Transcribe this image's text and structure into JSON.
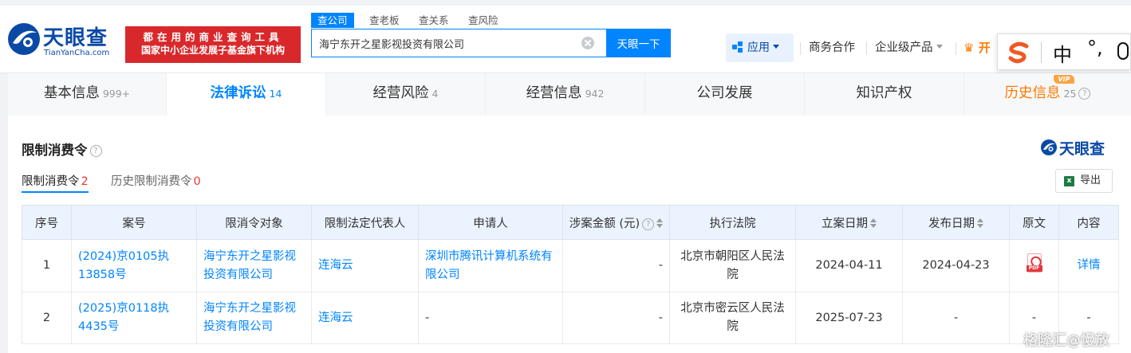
{
  "header": {
    "logo_cn": "天眼查",
    "logo_en": "TianYanCha.com",
    "slogan_line1": "都在用的商业查询工具",
    "slogan_line2": "国家中小企业发展子基金旗下机构",
    "search_tabs": [
      "查公司",
      "查老板",
      "查关系",
      "查风险"
    ],
    "search_value": "海宁东开之星影视投资有限公司",
    "search_button": "天眼一下",
    "app_label": "应用",
    "nav_business": "商务合作",
    "nav_products": "企业级产品",
    "open_label": "开",
    "brand_color": "#0084ff",
    "slogan_color": "#d9282b"
  },
  "ime": {
    "zh": "中",
    "punc": "°,"
  },
  "tabs": [
    {
      "label": "基本信息",
      "count": "999+"
    },
    {
      "label": "法律诉讼",
      "count": "14"
    },
    {
      "label": "经营风险",
      "count": "4"
    },
    {
      "label": "经营信息",
      "count": "942"
    },
    {
      "label": "公司发展",
      "count": ""
    },
    {
      "label": "知识产权",
      "count": ""
    },
    {
      "label": "历史信息",
      "count": "25"
    }
  ],
  "vip_badge": "VIP",
  "section": {
    "title": "限制消费令",
    "brand_text": "天眼查",
    "subtab_current": "限制消费令",
    "subtab_current_count": "2",
    "subtab_history": "历史限制消费令",
    "subtab_history_count": "0",
    "export_label": "导出"
  },
  "table": {
    "headers": [
      "序号",
      "案号",
      "限消令对象",
      "限制法定代表人",
      "申请人",
      "涉案金额 (元)",
      "执行法院",
      "立案日期",
      "发布日期",
      "原文",
      "内容"
    ],
    "rows": [
      {
        "index": "1",
        "case_no": "(2024)京0105执13858号",
        "target": "海宁东开之星影视投资有限公司",
        "legal_rep": "连海云",
        "applicant": "深圳市腾讯计算机系统有限公司",
        "amount": "-",
        "court": "北京市朝阳区人民法院",
        "filing_date": "2024-04-11",
        "publish_date": "2024-04-23",
        "original": "PDF",
        "detail": "详情"
      },
      {
        "index": "2",
        "case_no": "(2025)京0118执4435号",
        "target": "海宁东开之星影视投资有限公司",
        "legal_rep": "连海云",
        "applicant": "-",
        "amount": "-",
        "court": "北京市密云区人民法院",
        "filing_date": "2025-07-23",
        "publish_date": "-",
        "original": "-",
        "detail": "-"
      }
    ]
  },
  "watermark": "格隆汇@慢放"
}
